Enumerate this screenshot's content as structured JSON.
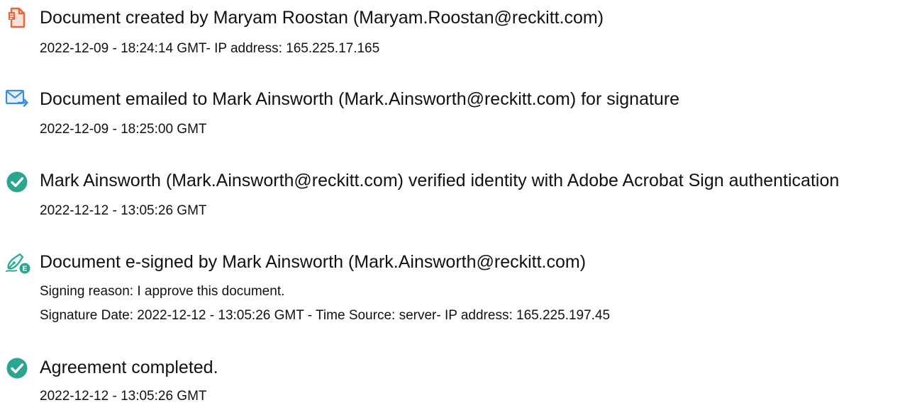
{
  "events": [
    {
      "icon": "document-created-icon",
      "title": "Document created by Maryam Roostan (Maryam.Roostan@reckitt.com)",
      "details": [
        "2022-12-09 - 18:24:14 GMT- IP address: 165.225.17.165"
      ]
    },
    {
      "icon": "email-sent-icon",
      "title": "Document emailed to Mark Ainsworth (Mark.Ainsworth@reckitt.com) for signature",
      "details": [
        "2022-12-09 - 18:25:00 GMT"
      ]
    },
    {
      "icon": "check-circle-icon",
      "title": "Mark Ainsworth (Mark.Ainsworth@reckitt.com) verified identity with Adobe Acrobat Sign authentication",
      "details": [
        "2022-12-12 - 13:05:26 GMT"
      ]
    },
    {
      "icon": "e-sign-pen-icon",
      "title": "Document e-signed by Mark Ainsworth (Mark.Ainsworth@reckitt.com)",
      "details": [
        "Signing reason: I approve this document.",
        "Signature Date: 2022-12-12 - 13:05:26 GMT - Time Source: server- IP address: 165.225.197.45"
      ]
    },
    {
      "icon": "check-circle-icon",
      "title": "Agreement completed.",
      "details": [
        "2022-12-12 - 13:05:26 GMT"
      ]
    }
  ],
  "colors": {
    "created_icon": "#e8643c",
    "email_icon": "#3b8fd9",
    "check_icon": "#2aa58f",
    "esign_icon": "#2aa58f"
  }
}
